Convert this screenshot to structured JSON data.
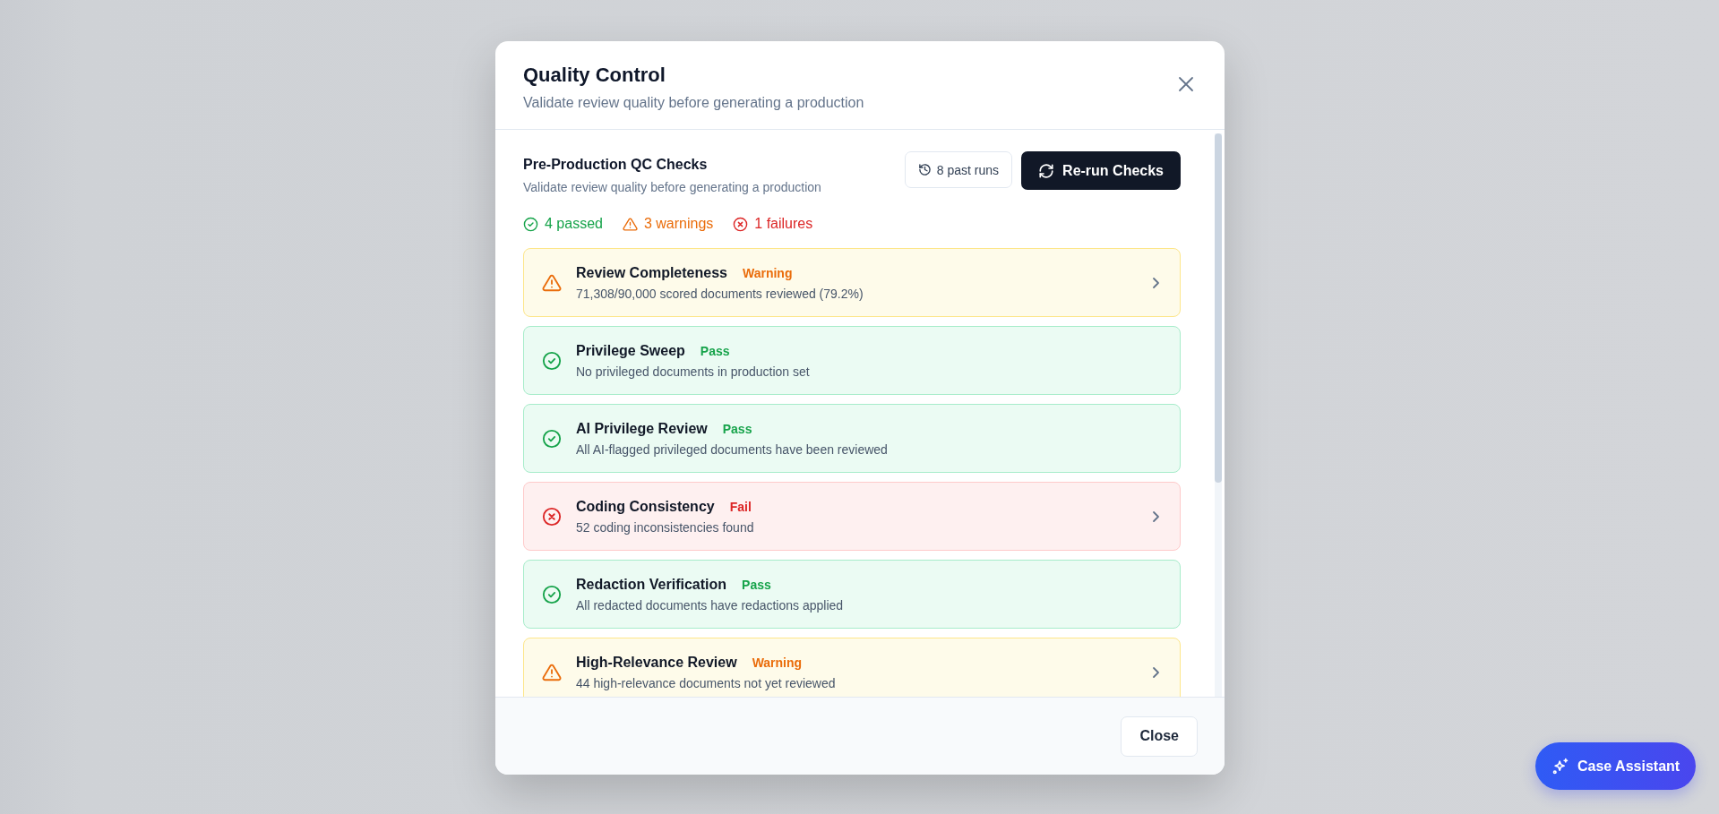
{
  "dialog": {
    "title": "Quality Control",
    "subtitle": "Validate review quality before generating a production"
  },
  "section": {
    "title": "Pre-Production QC Checks",
    "subtitle": "Validate review quality before generating a production",
    "history_button": "8 past runs",
    "rerun_button": "Re-run Checks"
  },
  "summary": [
    {
      "kind": "pass",
      "label": "4 passed"
    },
    {
      "kind": "warning",
      "label": "3 warnings"
    },
    {
      "kind": "fail",
      "label": "1 failures"
    }
  ],
  "checks": [
    {
      "kind": "warning",
      "title": "Review Completeness",
      "status": "Warning",
      "detail": "71,308/90,000 scored documents reviewed (79.2%)",
      "expandable": true
    },
    {
      "kind": "pass",
      "title": "Privilege Sweep",
      "status": "Pass",
      "detail": "No privileged documents in production set",
      "expandable": false
    },
    {
      "kind": "pass",
      "title": "AI Privilege Review",
      "status": "Pass",
      "detail": "All AI-flagged privileged documents have been reviewed",
      "expandable": false
    },
    {
      "kind": "fail",
      "title": "Coding Consistency",
      "status": "Fail",
      "detail": "52 coding inconsistencies found",
      "expandable": true
    },
    {
      "kind": "pass",
      "title": "Redaction Verification",
      "status": "Pass",
      "detail": "All redacted documents have redactions applied",
      "expandable": false
    },
    {
      "kind": "warning",
      "title": "High-Relevance Review",
      "status": "Warning",
      "detail": "44 high-relevance documents not yet reviewed",
      "expandable": true
    }
  ],
  "footer": {
    "close_button": "Close"
  },
  "assistant_button": "Case Assistant"
}
